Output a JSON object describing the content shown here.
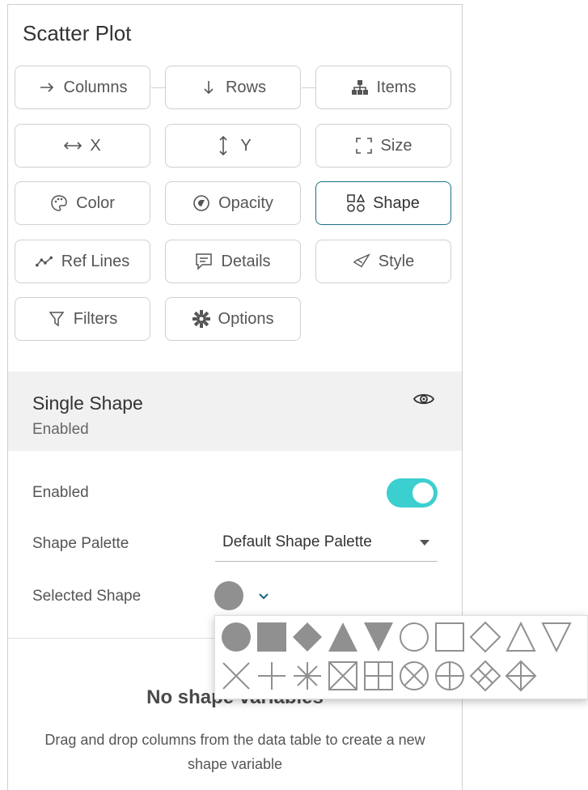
{
  "panel": {
    "title": "Scatter Plot"
  },
  "buttons": {
    "columns": "Columns",
    "rows": "Rows",
    "items": "Items",
    "x": "X",
    "y": "Y",
    "size": "Size",
    "color": "Color",
    "opacity": "Opacity",
    "shape": "Shape",
    "ref_lines": "Ref Lines",
    "details": "Details",
    "style": "Style",
    "filters": "Filters",
    "options": "Options"
  },
  "single_shape": {
    "title": "Single Shape",
    "subtitle": "Enabled",
    "enabled_label": "Enabled",
    "enabled": true,
    "palette_label": "Shape Palette",
    "palette_value": "Default Shape Palette",
    "selected_label": "Selected Shape",
    "selected_shape": "circle"
  },
  "empty_state": {
    "title": "No shape variables",
    "description": "Drag and drop columns from the data table to create a new shape variable"
  },
  "shape_picker": {
    "row1": [
      "circle",
      "square",
      "diamond",
      "triangle-up",
      "triangle-down",
      "circle-outline",
      "square-outline",
      "diamond-outline",
      "triangle-up-outline",
      "triangle-down-outline"
    ],
    "row2": [
      "x-cross",
      "plus",
      "asterisk",
      "square-x",
      "square-plus",
      "circle-x",
      "circle-plus",
      "diamond-x",
      "diamond-plus"
    ]
  },
  "colors": {
    "accent": "#1f6e86",
    "toggle": "#3ccfcf",
    "shape_fill": "#909090"
  }
}
